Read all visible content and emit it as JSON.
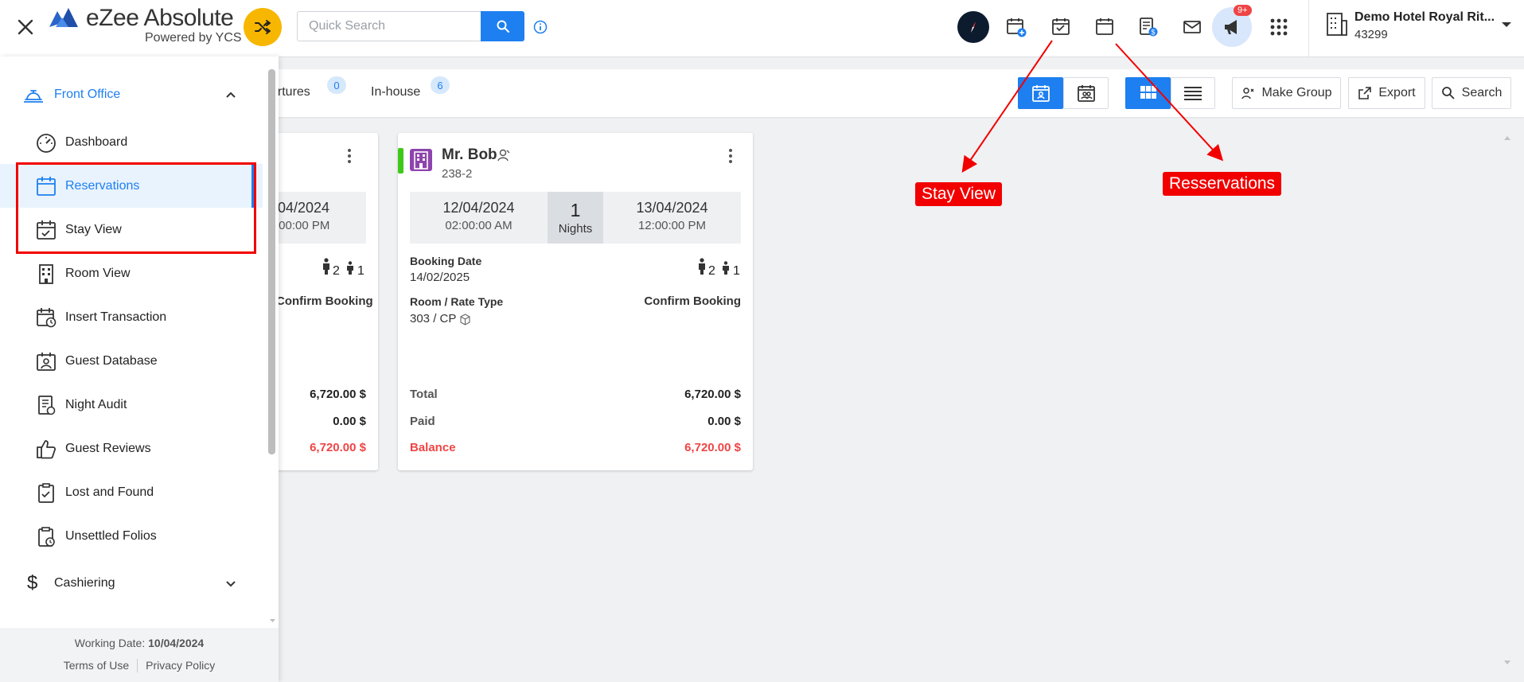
{
  "header": {
    "brand_title": "eZee Absolute",
    "brand_subtitle": "Powered by YCS",
    "search_placeholder": "Quick Search",
    "notification_badge": "9+",
    "hotel_name": "Demo Hotel Royal Rit...",
    "hotel_code": "43299"
  },
  "tabs": [
    {
      "label": "artures",
      "count": "0"
    },
    {
      "label": "In-house",
      "count": "6"
    }
  ],
  "toolbar": {
    "make_group": "Make Group",
    "export": "Export",
    "search": "Search"
  },
  "card_left": {
    "arrival_date_partial": "/04/2024",
    "arrival_time_partial": ":00:00 PM",
    "adults": "2",
    "children": "1",
    "status": "Confirm Booking",
    "total": "6,720.00 $",
    "paid": "0.00 $",
    "balance": "6,720.00 $"
  },
  "card_main": {
    "guest_name": "Mr. Bob",
    "booking_id": "238-2",
    "arrival_date": "12/04/2024",
    "arrival_time": "02:00:00 AM",
    "nights": "1",
    "nights_label": "Nights",
    "departure_date": "13/04/2024",
    "departure_time": "12:00:00 PM",
    "booking_date_label": "Booking Date",
    "booking_date": "14/02/2025",
    "adults": "2",
    "children": "1",
    "room_rate_label": "Room / Rate Type",
    "room_rate": "303 / CP",
    "status": "Confirm Booking",
    "total_label": "Total",
    "total": "6,720.00 $",
    "paid_label": "Paid",
    "paid": "0.00 $",
    "balance_label": "Balance",
    "balance": "6,720.00 $"
  },
  "sidebar": {
    "section": "Front Office",
    "items": [
      {
        "label": "Dashboard",
        "icon": "dashboard-gauge-icon"
      },
      {
        "label": "Reservations",
        "icon": "calendar-icon"
      },
      {
        "label": "Stay View",
        "icon": "calendar-check-icon"
      },
      {
        "label": "Room View",
        "icon": "building-icon"
      },
      {
        "label": "Insert Transaction",
        "icon": "calendar-clock-icon"
      },
      {
        "label": "Guest Database",
        "icon": "guest-card-icon"
      },
      {
        "label": "Night Audit",
        "icon": "audit-report-icon"
      },
      {
        "label": "Guest Reviews",
        "icon": "thumbs-up-icon"
      },
      {
        "label": "Lost and Found",
        "icon": "clipboard-check-icon"
      },
      {
        "label": "Unsettled Folios",
        "icon": "clipboard-clock-icon"
      }
    ],
    "cashiering": "Cashiering",
    "working_date_label": "Working Date:",
    "working_date": "10/04/2024",
    "terms": "Terms of Use",
    "privacy": "Privacy Policy"
  },
  "annotations": {
    "stay_view": "Stay View",
    "reservations": "Resservations"
  },
  "colors": {
    "primary": "#1e7ff0",
    "accent_yellow": "#f7b600",
    "danger": "#ef4545",
    "annotation_red": "#f20000",
    "purple": "#8e44ad",
    "status_green": "#3ec91a"
  }
}
